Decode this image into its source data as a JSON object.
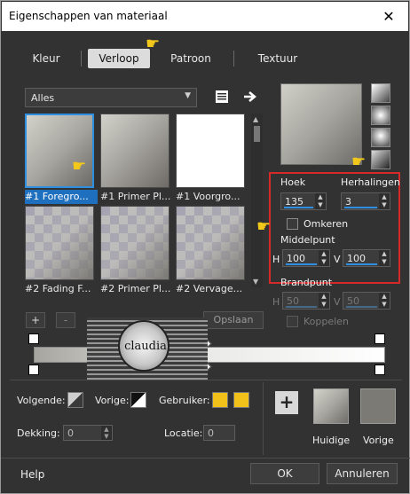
{
  "window": {
    "title": "Eigenschappen van materiaal",
    "close_glyph": "✕"
  },
  "tabs": [
    {
      "label": "Kleur",
      "active": false
    },
    {
      "label": "Verloop",
      "active": true
    },
    {
      "label": "Patroon",
      "active": false
    },
    {
      "label": "Textuur",
      "active": false
    }
  ],
  "category": {
    "selected": "Alles",
    "arrow": "▼"
  },
  "gallery": {
    "items": [
      {
        "caption": "#1 Foregro...",
        "selected": true
      },
      {
        "caption": "#1 Primer Pl...",
        "selected": false
      },
      {
        "caption": "#1 Voorgro...",
        "selected": false
      },
      {
        "caption": "#2 Fading F...",
        "selected": false
      },
      {
        "caption": "#2 Primer Pl...",
        "selected": false
      },
      {
        "caption": "#2 Vervage...",
        "selected": false
      }
    ]
  },
  "settings": {
    "hoek_label": "Hoek",
    "hoek_value": "135",
    "herhalingen_label": "Herhalingen",
    "herhalingen_value": "3",
    "omkeren_label": "Omkeren",
    "omkeren_checked": false,
    "middelpunt_label": "Middelpunt",
    "h_label": "H",
    "v_label": "V",
    "middelpunt_h": "100",
    "middelpunt_v": "100",
    "brandpunt_label": "Brandpunt",
    "brandpunt_h": "50",
    "brandpunt_v": "50",
    "koppelen_label": "Koppelen"
  },
  "editor": {
    "add_label": "+",
    "remove_label": "-",
    "save_label": "Opslaan",
    "watermark_text": "claudia"
  },
  "colors_row": {
    "volgende_label": "Volgende:",
    "vorige_label": "Vorige:",
    "gebruiker_label": "Gebruiker:",
    "gebruiker_color": "#f2c21a",
    "dekking_label": "Dekking:",
    "dekking_value": "0",
    "locatie_label": "Locatie:",
    "locatie_value": "0"
  },
  "swatches": {
    "add_label": "+",
    "current_label": "Huidige",
    "previous_label": "Vorige",
    "previous_color": "#7b7a74"
  },
  "footer": {
    "help_label": "Help",
    "ok_label": "OK",
    "cancel_label": "Annuleren"
  },
  "icons": [
    "close-icon",
    "dropdown-arrow-icon",
    "gradient-list-icon",
    "arrow-right-icon",
    "pointing-hand-icon"
  ]
}
